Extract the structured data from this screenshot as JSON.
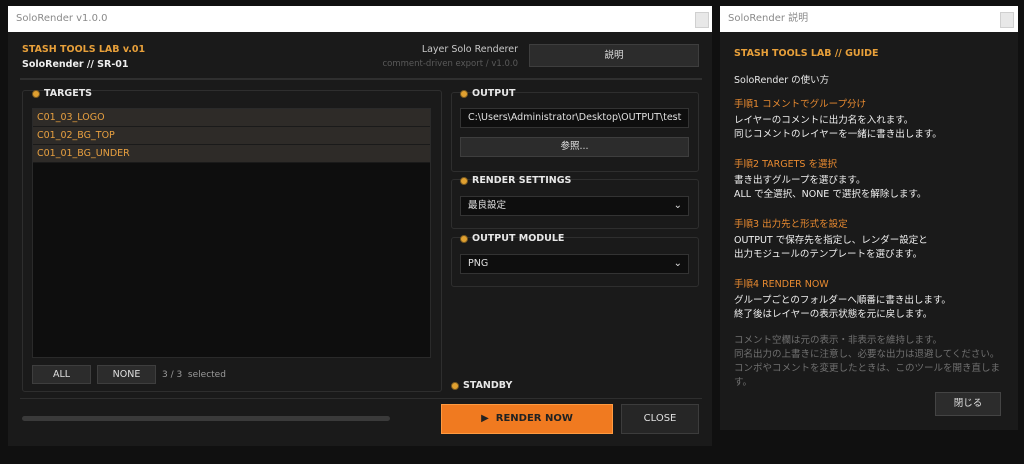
{
  "main_window": {
    "title": "SoloRender v1.0.0",
    "brand_line1": "STASH TOOLS LAB  v.01",
    "brand_line2": "SoloRender  //  SR-01",
    "subtitle1": "Layer Solo Renderer",
    "subtitle2": "comment-driven export  /  v1.0.0",
    "help_button": "説明"
  },
  "targets": {
    "title": "TARGETS",
    "items": [
      "C01_03_LOGO",
      "C01_02_BG_TOP",
      "C01_01_BG_UNDER"
    ],
    "all_button": "ALL",
    "none_button": "NONE",
    "selection_status": "3 / 3  selected"
  },
  "output": {
    "title": "OUTPUT",
    "path_value": "C:\\Users\\Administrator\\Desktop\\OUTPUT\\test",
    "browse_button": "参照..."
  },
  "render_settings": {
    "title": "RENDER SETTINGS",
    "selected": "最良設定"
  },
  "output_module": {
    "title": "OUTPUT MODULE",
    "selected": "PNG"
  },
  "status": {
    "text": "STANDBY"
  },
  "actions": {
    "render_now": "RENDER NOW",
    "close": "CLOSE"
  },
  "progress": {
    "value": 0
  },
  "guide_window": {
    "title": "SoloRender 説明",
    "brand": "STASH TOOLS LAB  //  GUIDE",
    "subtitle": "SoloRender の使い方",
    "steps": [
      {
        "heading": "手順1  コメントでグループ分け",
        "lines": [
          "レイヤーのコメントに出力名を入れます。",
          "同じコメントのレイヤーを一緒に書き出します。"
        ]
      },
      {
        "heading": "手順2  TARGETS を選択",
        "lines": [
          "書き出すグループを選びます。",
          "ALL で全選択、NONE で選択を解除します。"
        ]
      },
      {
        "heading": "手順3  出力先と形式を設定",
        "lines": [
          "OUTPUT で保存先を指定し、レンダー設定と",
          "出力モジュールのテンプレートを選びます。"
        ]
      },
      {
        "heading": "手順4  RENDER NOW",
        "lines": [
          "グループごとのフォルダーへ順番に書き出します。",
          "終了後はレイヤーの表示状態を元に戻します。"
        ]
      }
    ],
    "notes": [
      "コメント空欄は元の表示・非表示を維持します。",
      "同名出力の上書きに注意し、必要な出力は退避してください。",
      "コンポやコメントを変更したときは、このツールを開き直します。"
    ],
    "close_button": "閉じる"
  },
  "colors": {
    "accent_orange": "#f07a20",
    "brand_amber": "#e8a03a",
    "background": "#1a1a1a"
  }
}
